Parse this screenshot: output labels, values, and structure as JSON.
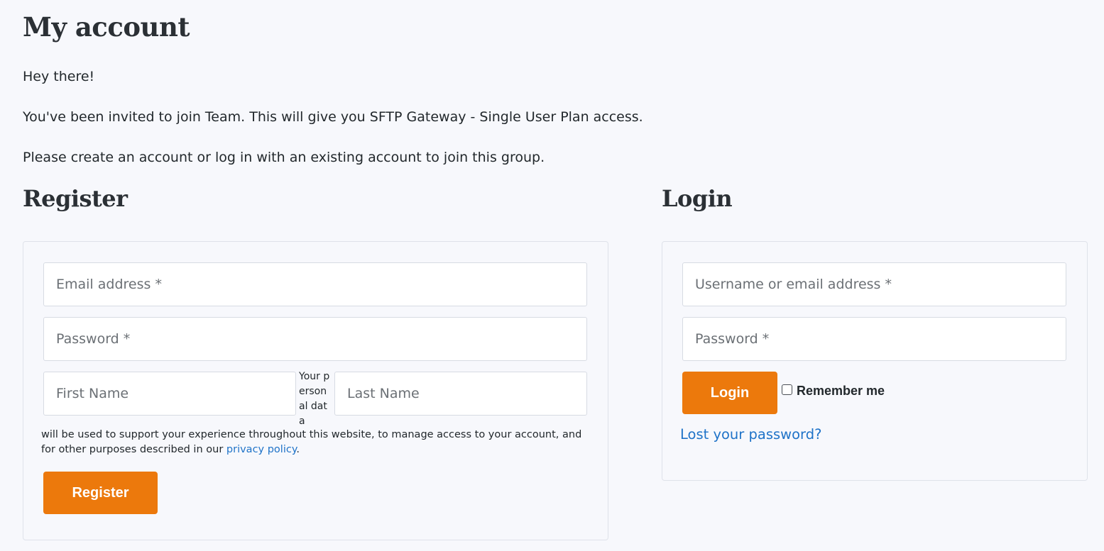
{
  "page": {
    "title": "My account"
  },
  "intro": {
    "greeting": "Hey there!",
    "invitation": "You've been invited to join Team. This will give you SFTP Gateway - Single User Plan access.",
    "instruction": "Please create an account or log in with an existing account to join this group."
  },
  "register": {
    "title": "Register",
    "email_placeholder": "Email address *",
    "password_placeholder": "Password *",
    "first_name_placeholder": "First Name",
    "last_name_placeholder": "Last Name",
    "privacy_fragment": "Your personal data",
    "privacy_text_before": "will be used to support your experience throughout this website, to manage access to your account, and for other purposes described in our ",
    "privacy_link": "privacy policy",
    "privacy_text_after": ".",
    "button_label": "Register"
  },
  "login": {
    "title": "Login",
    "username_placeholder": "Username or email address *",
    "password_placeholder": "Password *",
    "button_label": "Login",
    "remember_label": "Remember me",
    "remember_checked": false,
    "lost_password_link": "Lost your password?"
  },
  "colors": {
    "accent": "#ec790c",
    "link": "#1f73c8",
    "background": "#f7f8fc",
    "text": "#22282c"
  }
}
